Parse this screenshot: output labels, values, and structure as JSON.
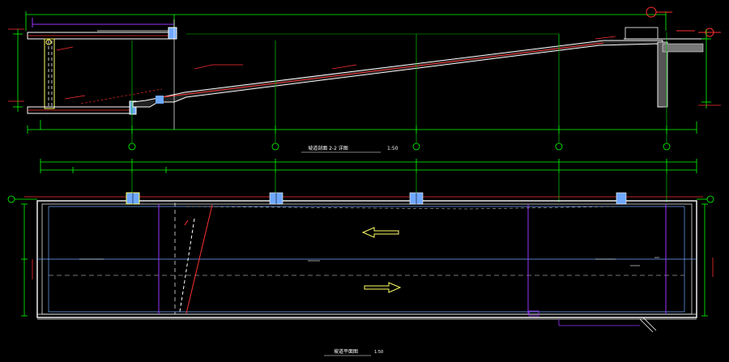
{
  "section": {
    "title": "坡道剖面  2-2  详图",
    "scale": "1:50",
    "bubbles": [
      "①",
      "⑪",
      "⑩",
      "⑫",
      "⑬",
      "⑭"
    ]
  },
  "plan": {
    "title": "坡道平面图",
    "scale": "1:50",
    "bubbles": [
      "②",
      "②"
    ]
  },
  "colors": {
    "background": "#000000",
    "dimension": "#00ff00",
    "outline": "#ffffff",
    "slope": "#ff3030",
    "axis": "#9a33ff",
    "grid": "#00c800",
    "arrow": "#ffff66",
    "column": "#6fa8ff"
  }
}
